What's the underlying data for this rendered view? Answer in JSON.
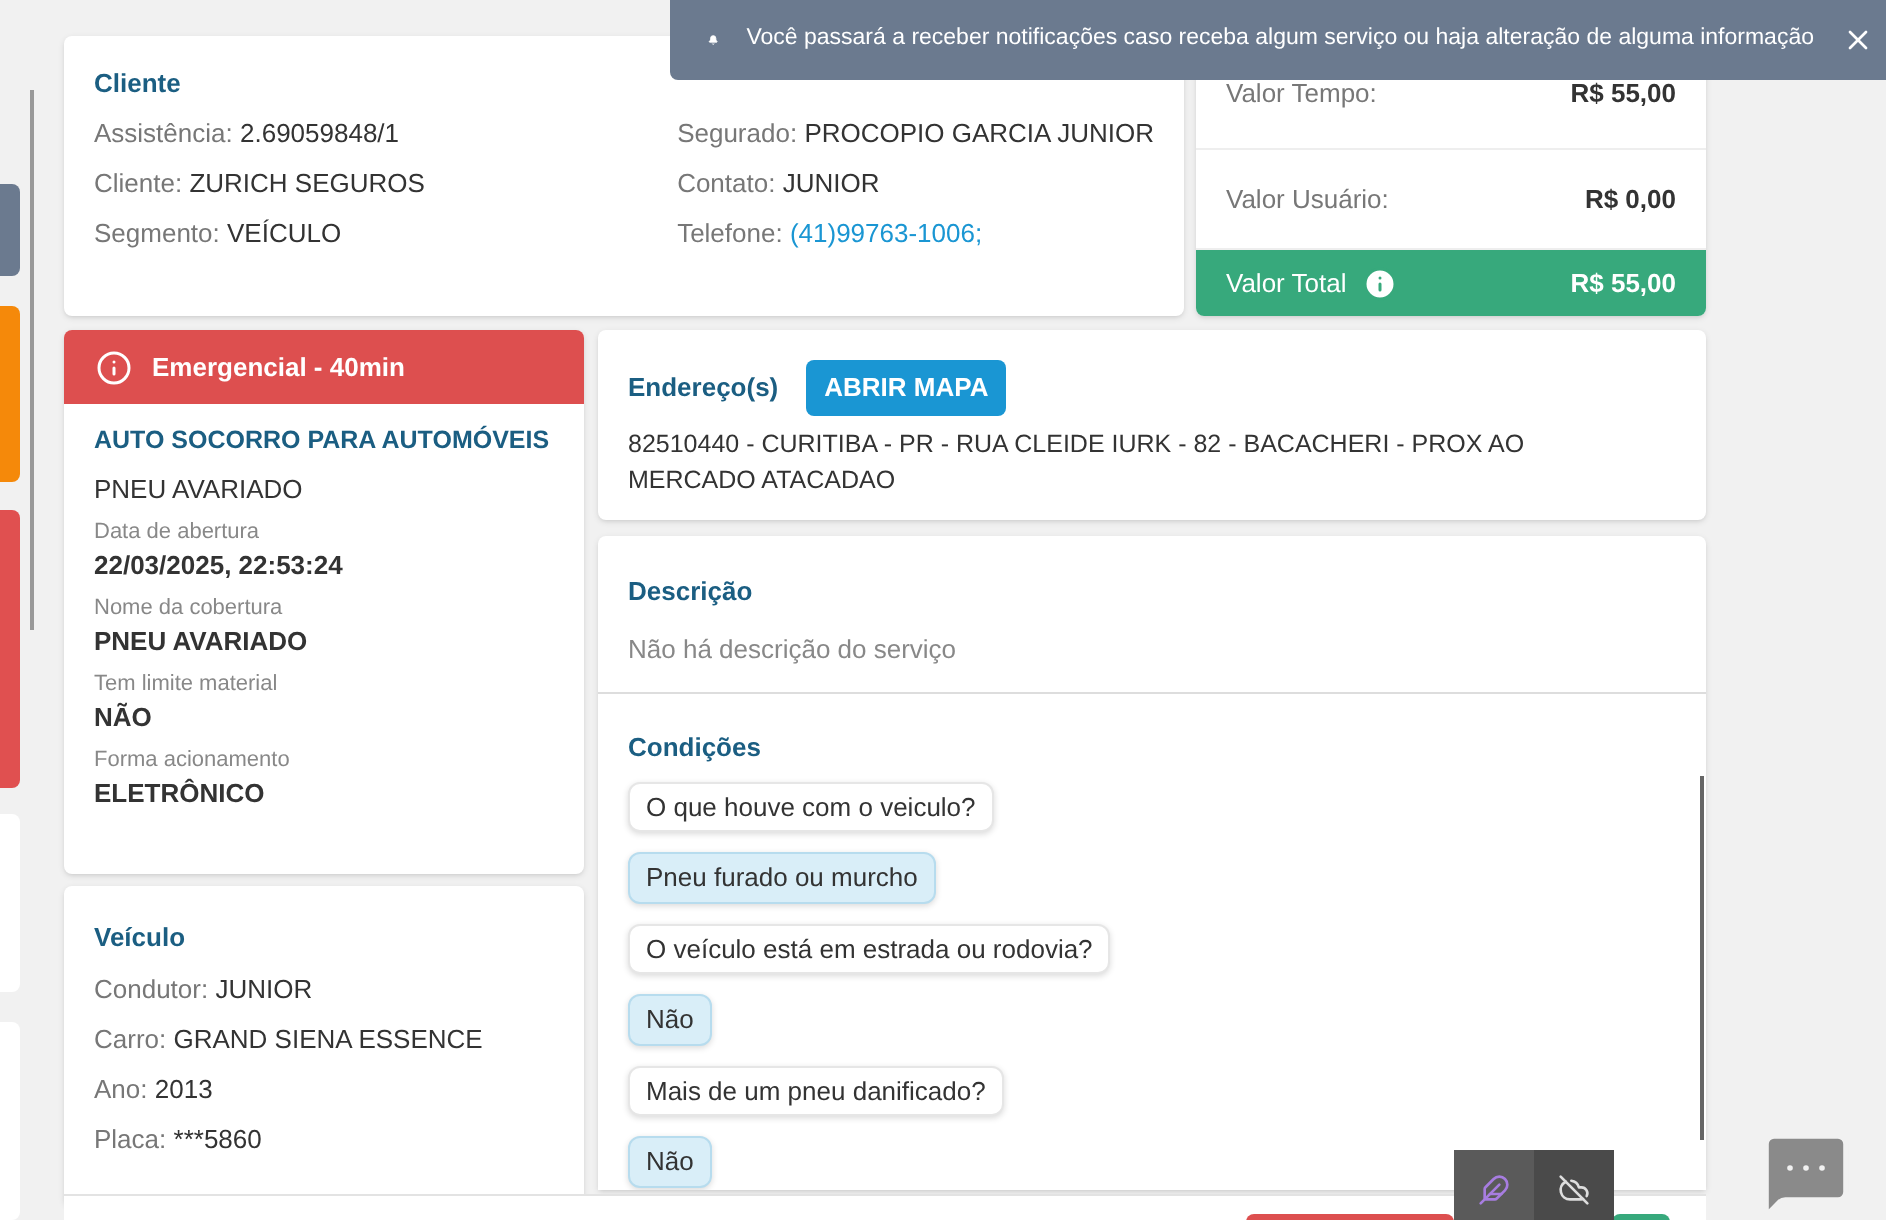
{
  "notification": {
    "text": "Você passará a receber notificações caso receba algum serviço ou haja alteração de alguma informação"
  },
  "client": {
    "title": "Cliente",
    "left": [
      {
        "label": "Assistência:",
        "value": "2.69059848/1",
        "kind": "text"
      },
      {
        "label": "Cliente:",
        "value": "ZURICH SEGUROS",
        "kind": "text"
      },
      {
        "label": "Segmento:",
        "value": "VEÍCULO",
        "kind": "text"
      }
    ],
    "right": [
      {
        "label": "Segurado:",
        "value": "PROCOPIO GARCIA JUNIOR",
        "kind": "text"
      },
      {
        "label": "Contato:",
        "value": "JUNIOR",
        "kind": "text"
      },
      {
        "label": "Telefone:",
        "value": "(41)99763-1006;",
        "kind": "link"
      }
    ]
  },
  "values": {
    "rows": [
      {
        "label": "Valor Tempo:",
        "value": "R$ 55,00"
      },
      {
        "label": "Valor Usuário:",
        "value": "R$ 0,00"
      }
    ],
    "total": {
      "label": "Valor Total",
      "value": "R$ 55,00"
    }
  },
  "service": {
    "badge": "Emergencial - 40min",
    "title": "AUTO SOCORRO PARA AUTOMÓVEIS",
    "subtitle": "PNEU AVARIADO",
    "fields": [
      {
        "label": "Data de abertura",
        "value": "22/03/2025, 22:53:24"
      },
      {
        "label": "Nome da cobertura",
        "value": "PNEU AVARIADO"
      },
      {
        "label": "Tem limite material",
        "value": "NÃO"
      },
      {
        "label": "Forma acionamento",
        "value": "ELETRÔNICO"
      }
    ]
  },
  "vehicle": {
    "title": "Veículo",
    "fields": [
      {
        "label": "Condutor:",
        "value": "JUNIOR"
      },
      {
        "label": "Carro:",
        "value": "GRAND SIENA ESSENCE"
      },
      {
        "label": "Ano:",
        "value": "2013"
      },
      {
        "label": "Placa:",
        "value": "***5860"
      }
    ]
  },
  "address": {
    "title": "Endereço(s)",
    "button": "ABRIR MAPA",
    "text": "82510440 - CURITIBA - PR - RUA CLEIDE IURK - 82 - BACACHERI - PROX AO MERCADO ATACADAO"
  },
  "description": {
    "title": "Descrição",
    "text": "Não há descrição do serviço"
  },
  "conditions": {
    "title": "Condições",
    "messages": [
      {
        "kind": "question",
        "text": "O que houve com o veiculo?"
      },
      {
        "kind": "answer",
        "text": "Pneu furado ou murcho"
      },
      {
        "kind": "question",
        "text": "O veículo está em estrada ou rodovia?"
      },
      {
        "kind": "answer",
        "text": "Não"
      },
      {
        "kind": "question",
        "text": "Mais de um pneu danificado?"
      },
      {
        "kind": "answer",
        "text": "Não"
      }
    ]
  }
}
